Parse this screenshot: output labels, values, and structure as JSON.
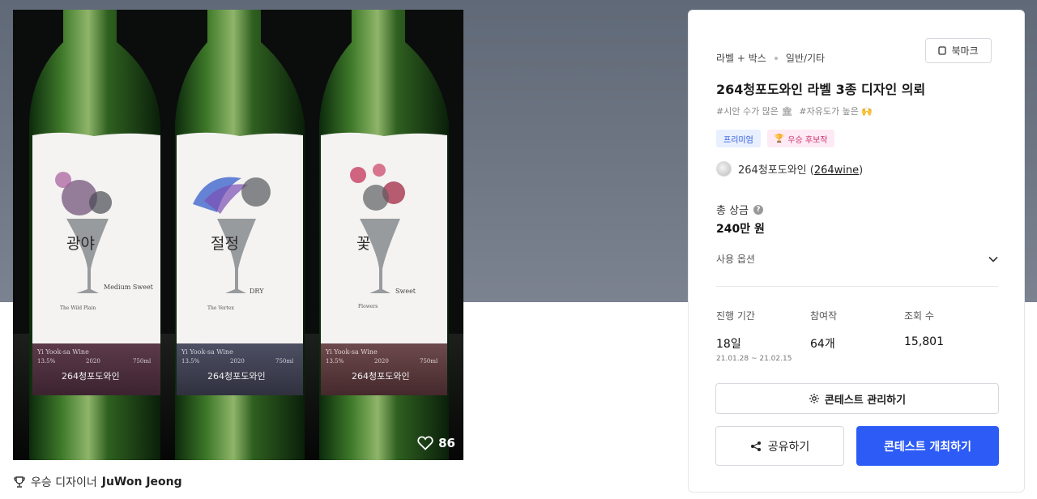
{
  "image": {
    "likes": "86",
    "bottles": [
      {
        "name": "광야",
        "en": "The Wild Plain",
        "taste": "Medium Sweet",
        "brand": "264청포도와인",
        "band": "Yi Yook-sa Wine",
        "abv": "13.5%",
        "year": "2020",
        "volume": "750ml"
      },
      {
        "name": "절정",
        "en": "The Vertex",
        "taste": "DRY",
        "brand": "264청포도와인",
        "band": "Yi Yook-sa Wine",
        "abv": "13.5%",
        "year": "2020",
        "volume": "750ml"
      },
      {
        "name": "꽃",
        "en": "Flowers",
        "taste": "Sweet",
        "brand": "264청포도와인",
        "band": "Yi Yook-sa Wine",
        "abv": "13.5%",
        "year": "2020",
        "volume": "750ml"
      }
    ]
  },
  "winner": {
    "prefix": "우승 디자이너",
    "name": "JuWon Jeong"
  },
  "panel": {
    "category": "라벨 + 박스",
    "subcategory": "일반/기타",
    "bookmark": "북마크",
    "title": "264청포도와인 라벨 3종 디자인 의뢰",
    "tags": [
      "#시안 수가 많은 🏛",
      "#자유도가 높은 🙌"
    ],
    "badge_premium": "프리미엄",
    "badge_winner": "우승 후보작",
    "host_name": "264청포도와인 (",
    "host_id": "264wine",
    "host_close": ")",
    "prize_label": "총 상금",
    "prize_value": "240만 원",
    "usage_label": "사용 옵션",
    "stats": [
      {
        "label": "진행 기간",
        "value": "18일",
        "sub": "21.01.28 ~ 21.02.15"
      },
      {
        "label": "참여작",
        "value": "64개",
        "sub": ""
      },
      {
        "label": "조회 수",
        "value": "15,801",
        "sub": ""
      }
    ],
    "manage_label": "콘테스트 관리하기",
    "share_label": "공유하기",
    "host_contest_label": "콘테스트 개최하기"
  },
  "colors": {
    "primary": "#2c5bf6",
    "premium_text": "#2b58e0",
    "winner_text": "#d1336f"
  }
}
